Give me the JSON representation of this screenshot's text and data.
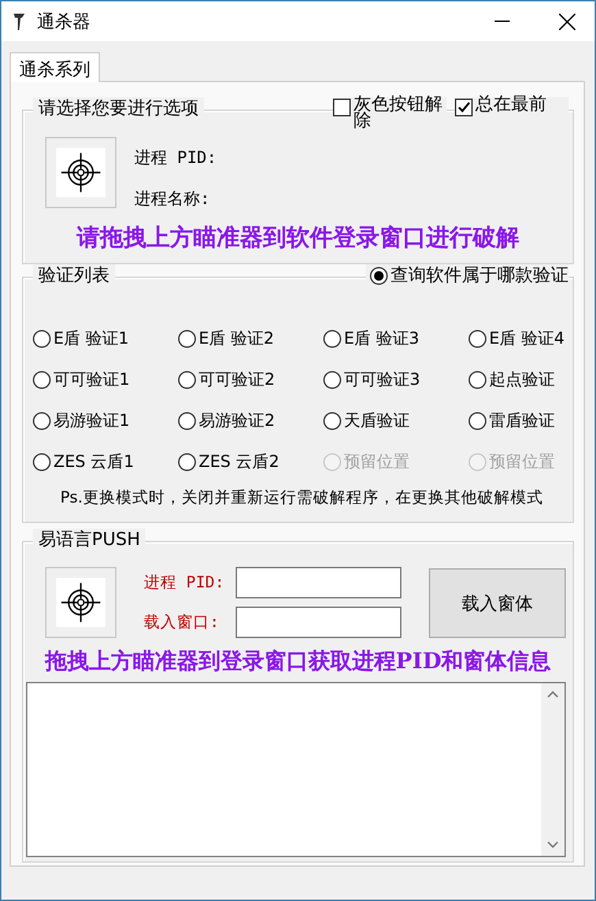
{
  "window": {
    "title": "通杀器"
  },
  "tabs": [
    {
      "label": "通杀系列",
      "selected": true
    }
  ],
  "options_group": {
    "title": "请选择您要进行选项",
    "checkboxes": [
      {
        "label": "灰色按钮解除",
        "checked": false
      },
      {
        "label": "总在最前",
        "checked": true
      }
    ],
    "pid_label": "进程 PID:",
    "name_label": "进程名称:",
    "hint": "请拖拽上方瞄准器到软件登录窗口进行破解"
  },
  "verify_group": {
    "title": "验证列表",
    "query_radio": {
      "label": "查询软件属于哪款验证",
      "selected": true
    },
    "radios": [
      {
        "label": "E盾 验证1",
        "selected": false,
        "disabled": false
      },
      {
        "label": "E盾 验证2",
        "selected": false,
        "disabled": false
      },
      {
        "label": "E盾 验证3",
        "selected": false,
        "disabled": false
      },
      {
        "label": "E盾 验证4",
        "selected": false,
        "disabled": false
      },
      {
        "label": "可可验证1",
        "selected": false,
        "disabled": false
      },
      {
        "label": "可可验证2",
        "selected": false,
        "disabled": false
      },
      {
        "label": "可可验证3",
        "selected": false,
        "disabled": false
      },
      {
        "label": "起点验证",
        "selected": false,
        "disabled": false
      },
      {
        "label": "易游验证1",
        "selected": false,
        "disabled": false
      },
      {
        "label": "易游验证2",
        "selected": false,
        "disabled": false
      },
      {
        "label": "天盾验证",
        "selected": false,
        "disabled": false
      },
      {
        "label": "雷盾验证",
        "selected": false,
        "disabled": false
      },
      {
        "label": "ZES 云盾1",
        "selected": false,
        "disabled": false
      },
      {
        "label": "ZES 云盾2",
        "selected": false,
        "disabled": false
      },
      {
        "label": "预留位置",
        "selected": false,
        "disabled": true
      },
      {
        "label": "预留位置",
        "selected": false,
        "disabled": true
      }
    ],
    "note": "Ps.更换模式时，关闭并重新运行需破解程序，在更换其他破解模式"
  },
  "push_group": {
    "title": "易语言PUSH",
    "fields": [
      {
        "label": "进程 PID:"
      },
      {
        "label": "载入窗口:"
      }
    ],
    "button": "载入窗体",
    "hint": "拖拽上方瞄准器到登录窗口获取进程PID和窗体信息"
  }
}
